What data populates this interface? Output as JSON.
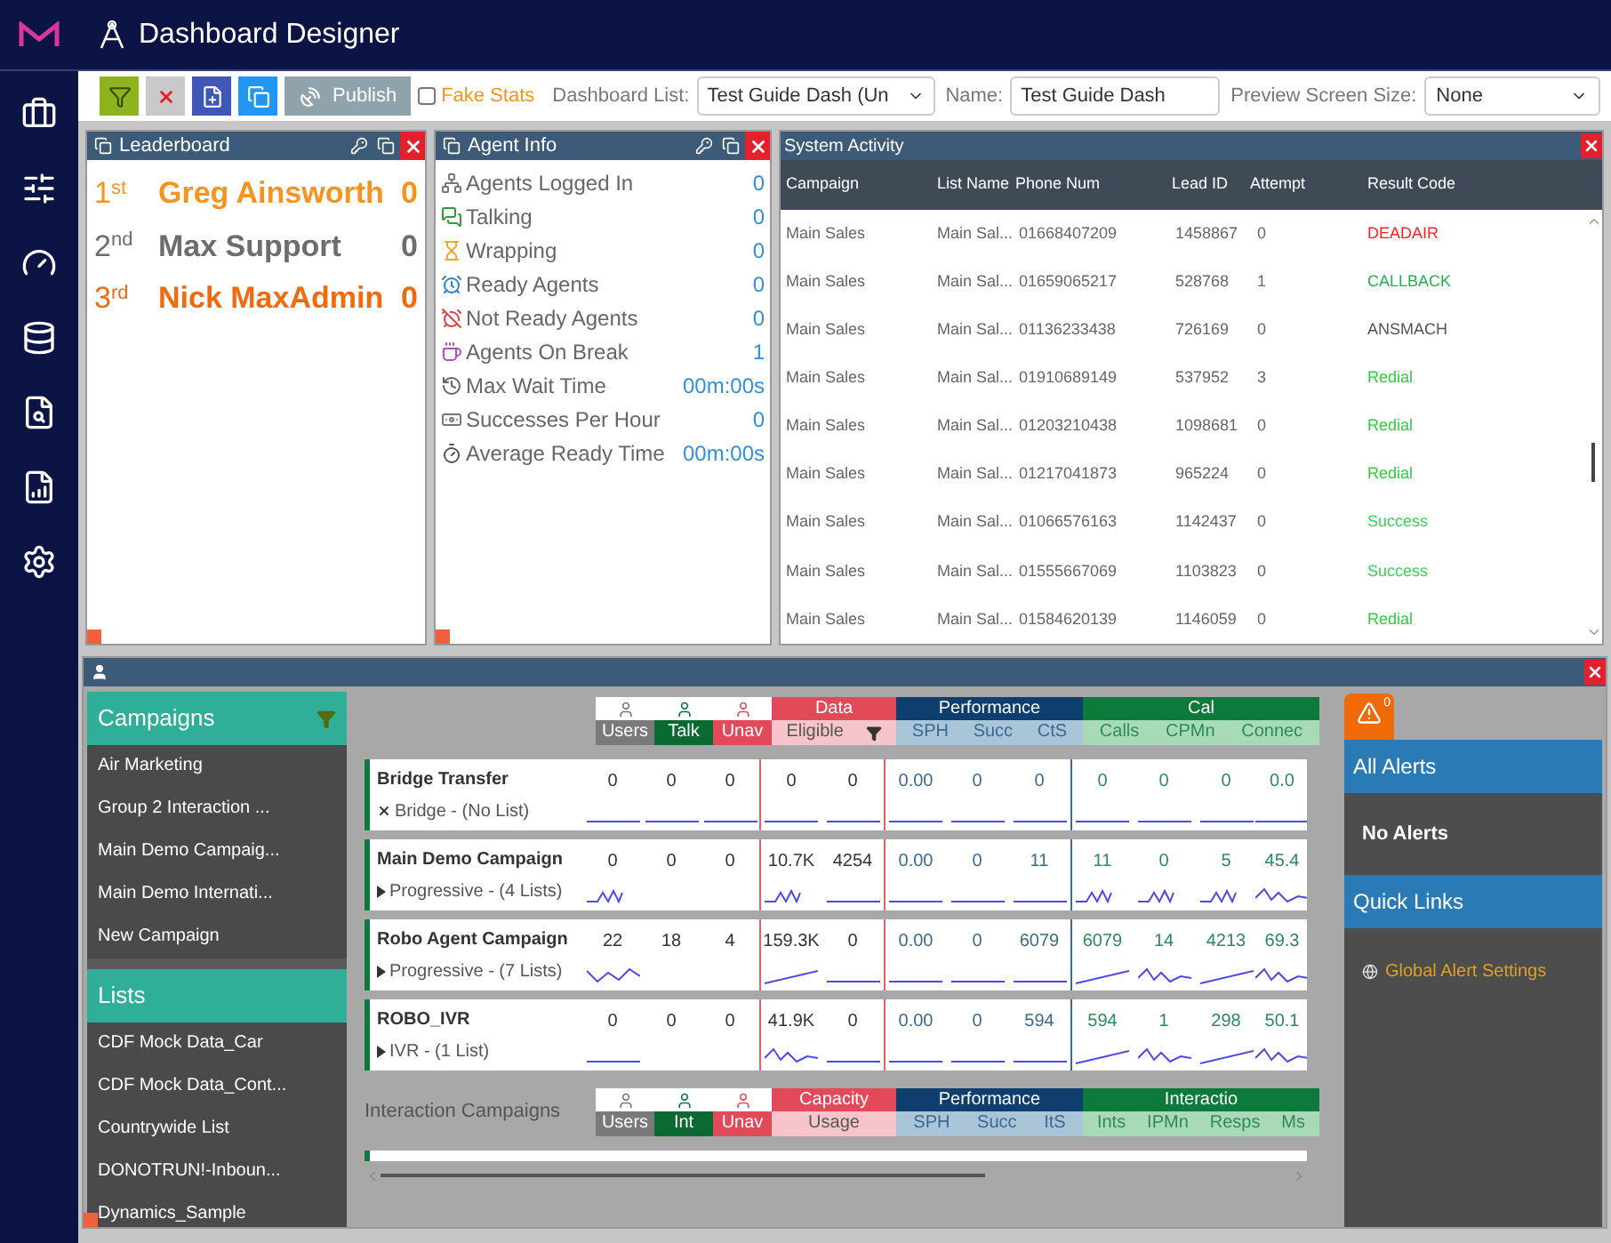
{
  "header": {
    "title": "Dashboard Designer"
  },
  "toolbar": {
    "publish": "Publish",
    "fake_stats": {
      "label": "Fake Stats",
      "checked": false
    },
    "dashboard_list": {
      "label": "Dashboard List:",
      "value": "Test Guide Dash (Un"
    },
    "name": {
      "label": "Name:",
      "value": "Test Guide Dash"
    },
    "preview_size": {
      "label": "Preview Screen Size:",
      "value": "None"
    }
  },
  "leaderboard": {
    "title": "Leaderboard",
    "entries": [
      {
        "rank": "1",
        "suffix": "st",
        "name": "Greg Ainsworth",
        "score": "0",
        "color": "#f7941d"
      },
      {
        "rank": "2",
        "suffix": "nd",
        "name": "Max Support",
        "score": "0",
        "color": "#6d6d6d"
      },
      {
        "rank": "3",
        "suffix": "rd",
        "name": "Nick MaxAdmin",
        "score": "0",
        "color": "#f26a10"
      }
    ]
  },
  "agent_info": {
    "title": "Agent Info",
    "stats": [
      {
        "kind": "logged-in",
        "label": "Agents Logged In",
        "value": "0"
      },
      {
        "kind": "talking",
        "label": "Talking",
        "value": "0"
      },
      {
        "kind": "wrapping",
        "label": "Wrapping",
        "value": "0"
      },
      {
        "kind": "ready",
        "label": "Ready Agents",
        "value": "0"
      },
      {
        "kind": "not-ready",
        "label": "Not Ready Agents",
        "value": "0"
      },
      {
        "kind": "break",
        "label": "Agents On Break",
        "value": "1"
      },
      {
        "kind": "wait",
        "label": "Max Wait Time",
        "value": "00m:00s"
      },
      {
        "kind": "successes",
        "label": "Successes Per Hour",
        "value": "0"
      },
      {
        "kind": "ready-time",
        "label": "Average Ready Time",
        "value": "00m:00s"
      }
    ]
  },
  "system_activity": {
    "title": "System Activity",
    "columns": [
      "Campaign",
      "List Name",
      "Phone Num",
      "Lead ID",
      "Attempt",
      "Result Code"
    ],
    "rows": [
      {
        "cells": [
          "Main Sales",
          "Main Sal...",
          "01668407209",
          "1458867",
          "0",
          "DEADAIR"
        ],
        "color": "#ff2020"
      },
      {
        "cells": [
          "Main Sales",
          "Main Sal...",
          "01659065217",
          "528768",
          "1",
          "CALLBACK"
        ],
        "color": "#22b14c"
      },
      {
        "cells": [
          "Main Sales",
          "Main Sal...",
          "01136233438",
          "726169",
          "0",
          "ANSMACH"
        ],
        "color": "#555555"
      },
      {
        "cells": [
          "Main Sales",
          "Main Sal...",
          "01910689149",
          "537952",
          "3",
          "Redial"
        ],
        "color": "#2ecc40"
      },
      {
        "cells": [
          "Main Sales",
          "Main Sal...",
          "01203210438",
          "1098681",
          "0",
          "Redial"
        ],
        "color": "#2ecc40"
      },
      {
        "cells": [
          "Main Sales",
          "Main Sal...",
          "01217041873",
          "965224",
          "0",
          "Redial"
        ],
        "color": "#2ecc40"
      },
      {
        "cells": [
          "Main Sales",
          "Main Sal...",
          "01066576163",
          "1142437",
          "0",
          "Success"
        ],
        "color": "#39d353"
      },
      {
        "cells": [
          "Main Sales",
          "Main Sal...",
          "01555667069",
          "1103823",
          "0",
          "Success"
        ],
        "color": "#39d353"
      },
      {
        "cells": [
          "Main Sales",
          "Main Sal...",
          "01584620139",
          "1146059",
          "0",
          "Redial"
        ],
        "color": "#2ecc40"
      }
    ]
  },
  "sidebar_lists": {
    "campaigns": {
      "title": "Campaigns",
      "items": [
        "Air Marketing",
        "Group 2 Interaction ...",
        "Main Demo Campaig...",
        "Main Demo Internati...",
        "New Campaign"
      ]
    },
    "lists": {
      "title": "Lists",
      "items": [
        "CDF Mock Data_Car",
        "CDF Mock Data_Cont...",
        "Countrywide List",
        "DONOTRUN!-Inboun...",
        "Dynamics_Sample"
      ]
    }
  },
  "dial_table": {
    "user_columns": [
      "Users",
      "Talk",
      "Unav"
    ],
    "groups": [
      {
        "kind": "data",
        "title": "Data",
        "columns": [
          "Eligible"
        ]
      },
      {
        "kind": "performance",
        "title": "Performance",
        "columns": [
          "SPH",
          "Succ",
          "CtS"
        ]
      },
      {
        "kind": "calls",
        "title": "Cal",
        "columns": [
          "Calls",
          "CPMn",
          "Connec"
        ]
      }
    ],
    "rows": [
      {
        "name": "Bridge Transfer",
        "kind": "bridge",
        "mode": "Bridge - (No List)",
        "values": [
          "0",
          "0",
          "0",
          "0",
          "0",
          "0.00",
          "0",
          "0",
          "0",
          "0",
          "0",
          "0.0"
        ]
      },
      {
        "name": "Main Demo Campaign",
        "kind": "progressive",
        "mode": "Progressive - (4 Lists)",
        "values": [
          "0",
          "0",
          "0",
          "10.7K",
          "4254",
          "0.00",
          "0",
          "11",
          "11",
          "0",
          "5",
          "45.4"
        ]
      },
      {
        "name": "Robo Agent Campaign",
        "kind": "progressive",
        "mode": "Progressive - (7 Lists)",
        "values": [
          "22",
          "18",
          "4",
          "159.3K",
          "0",
          "0.00",
          "0",
          "6079",
          "6079",
          "14",
          "4213",
          "69.3"
        ]
      },
      {
        "name": "ROBO_IVR",
        "kind": "progressive",
        "mode": "IVR - (1 List)",
        "values": [
          "0",
          "0",
          "0",
          "41.9K",
          "0",
          "0.00",
          "0",
          "594",
          "594",
          "1",
          "298",
          "50.1"
        ]
      }
    ]
  },
  "interaction_table": {
    "title": "Interaction Campaigns",
    "user_columns": [
      "Users",
      "Int",
      "Unav"
    ],
    "groups": [
      {
        "kind": "data",
        "title": "Capacity",
        "columns": [
          "Usage"
        ]
      },
      {
        "kind": "performance",
        "title": "Performance",
        "columns": [
          "SPH",
          "Succ",
          "ItS"
        ]
      },
      {
        "kind": "calls",
        "title": "Interactio",
        "columns": [
          "Ints",
          "IPMn",
          "Resps",
          "Ms"
        ]
      }
    ]
  },
  "alerts": {
    "badge": "0",
    "sections": [
      {
        "kind": "message",
        "title": "All Alerts",
        "text": "No Alerts"
      },
      {
        "kind": "link",
        "title": "Quick Links",
        "text": "Global Alert Settings"
      }
    ]
  }
}
